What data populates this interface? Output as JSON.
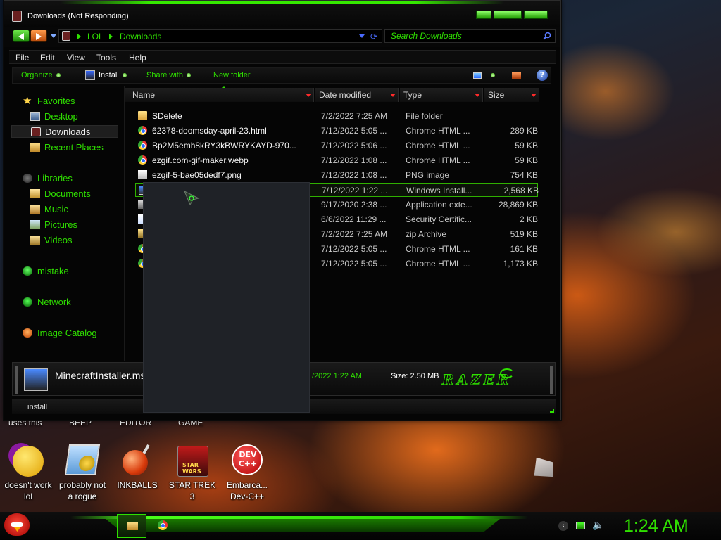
{
  "window": {
    "title": "Downloads (Not Responding)",
    "accent": "#2fe000"
  },
  "address": {
    "crumbs": [
      "LOL",
      "Downloads"
    ],
    "search_placeholder": "Search Downloads"
  },
  "menu": [
    "File",
    "Edit",
    "View",
    "Tools",
    "Help"
  ],
  "commands": {
    "organize": "Organize",
    "install": "Install",
    "share": "Share with",
    "new_folder": "New folder",
    "help": "?"
  },
  "nav": {
    "favorites": "Favorites",
    "desktop": "Desktop",
    "downloads": "Downloads",
    "recent": "Recent Places",
    "libraries": "Libraries",
    "documents": "Documents",
    "music": "Music",
    "pictures": "Pictures",
    "videos": "Videos",
    "user": "mistake",
    "network": "Network",
    "catalog": "Image Catalog"
  },
  "columns": {
    "name": "Name",
    "date": "Date modified",
    "type": "Type",
    "size": "Size"
  },
  "files": [
    {
      "icon": "folder-icon",
      "name": "SDelete",
      "date": "7/2/2022 7:25 AM",
      "type": "File folder",
      "size": ""
    },
    {
      "icon": "chrome-icon",
      "name": "62378-doomsday-april-23.html",
      "date": "7/12/2022 5:05 ...",
      "type": "Chrome HTML ...",
      "size": "289 KB"
    },
    {
      "icon": "chrome-icon",
      "name": "Bp2M5emh8kRY3kBWRYKAYD-970...",
      "date": "7/12/2022 5:06 ...",
      "type": "Chrome HTML ...",
      "size": "59 KB"
    },
    {
      "icon": "chrome-icon",
      "name": "ezgif.com-gif-maker.webp",
      "date": "7/12/2022 1:08 ...",
      "type": "Chrome HTML ...",
      "size": "59 KB"
    },
    {
      "icon": "png-icon",
      "name": "ezgif-5-bae05dedf7.png",
      "date": "7/12/2022 1:08 ...",
      "type": "PNG image",
      "size": "754 KB"
    },
    {
      "icon": "msi-icon",
      "name": "",
      "date": "7/12/2022 1:22 ...",
      "type": "Windows Install...",
      "size": "2,568 KB"
    },
    {
      "icon": "app-ext-icon",
      "name": "",
      "date": "9/17/2020 2:38 ...",
      "type": "Application exte...",
      "size": "28,869 KB"
    },
    {
      "icon": "certificate-icon",
      "name": "",
      "date": "6/6/2022 11:29 ...",
      "type": "Security Certific...",
      "size": "2 KB"
    },
    {
      "icon": "zip-icon",
      "name": "",
      "date": "7/2/2022 7:25 AM",
      "type": "zip Archive",
      "size": "519 KB"
    },
    {
      "icon": "chrome-icon",
      "name": "",
      "date": "7/12/2022 5:05 ...",
      "type": "Chrome HTML ...",
      "size": "161 KB"
    },
    {
      "icon": "chrome-icon",
      "name": "",
      "date": "7/12/2022 5:05 ...",
      "type": "Chrome HTML ...",
      "size": "1,173 KB"
    }
  ],
  "selected_index": 5,
  "details": {
    "name": "MinecraftInstaller.ms",
    "date": "/2022 1:22 AM",
    "size": "Size:  2.50 MB",
    "brand": "RAZER"
  },
  "status": {
    "text": "install"
  },
  "desktop": {
    "top_labels": [
      "uses this",
      "BEEP",
      "EDITOR",
      "GAME"
    ],
    "icons": [
      {
        "icon": "yahoo-messenger-icon",
        "line1": "doesn't work",
        "line2": "lol"
      },
      {
        "icon": "gears-icon",
        "line1": "probably not",
        "line2": "a rogue"
      },
      {
        "icon": "inkball-icon",
        "line1": "INKBALLS",
        "line2": ""
      },
      {
        "icon": "star-wars-icon",
        "line1": "STAR TREK",
        "line2": "3"
      },
      {
        "icon": "dev-cpp-icon",
        "line1": "Embarca...",
        "line2": "Dev-C++"
      }
    ],
    "star_wars_text": "STAR WARS",
    "dev_text": "DEV C++"
  },
  "taskbar": {
    "clock": "1:24 AM"
  }
}
